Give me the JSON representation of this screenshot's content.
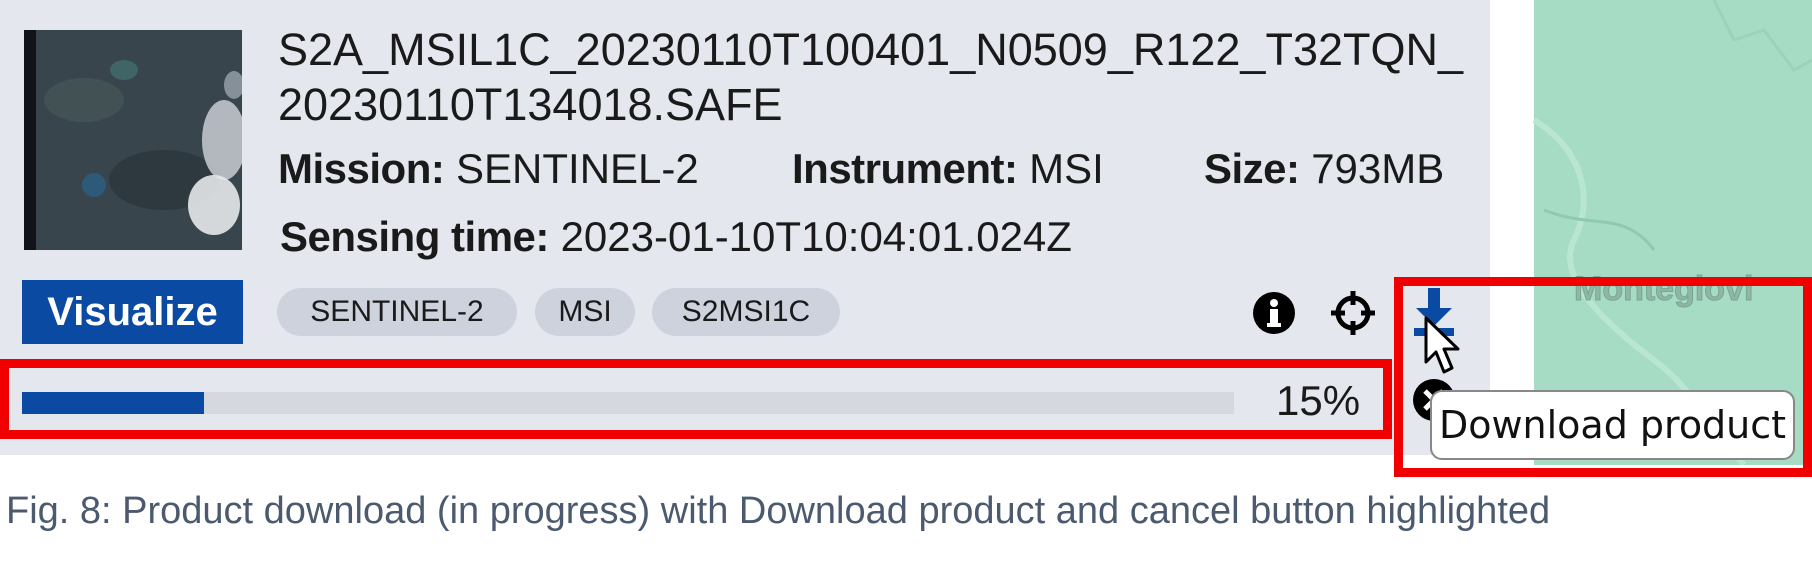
{
  "product": {
    "title": "S2A_MSIL1C_20230110T100401_N0509_R122_T32TQN_20230110T134018.SAFE",
    "mission_label": "Mission:",
    "mission_value": "SENTINEL-2",
    "instrument_label": "Instrument:",
    "instrument_value": "MSI",
    "size_label": "Size:",
    "size_value": "793MB",
    "sensing_label": "Sensing time:",
    "sensing_value": "2023-01-10T10:04:01.024Z"
  },
  "actions": {
    "visualize_label": "Visualize",
    "info_icon": "info-icon",
    "locate_icon": "crosshair-icon",
    "download_icon": "download-icon",
    "cancel_icon": "cancel-icon"
  },
  "tags": [
    "SENTINEL-2",
    "MSI",
    "S2MSI1C"
  ],
  "download": {
    "progress_fraction": 0.15,
    "progress_text": "15%"
  },
  "tooltip": {
    "text": "Download product"
  },
  "map": {
    "place_label": "Montegiovi"
  },
  "caption": {
    "text": "Fig. 8: Product download (in progress) with Download product and cancel button highlighted"
  },
  "colors": {
    "accent": "#0b4aa2",
    "highlight": "#f00000",
    "card_background": "#e4e8ee",
    "map_land": "#a6dcc4"
  }
}
